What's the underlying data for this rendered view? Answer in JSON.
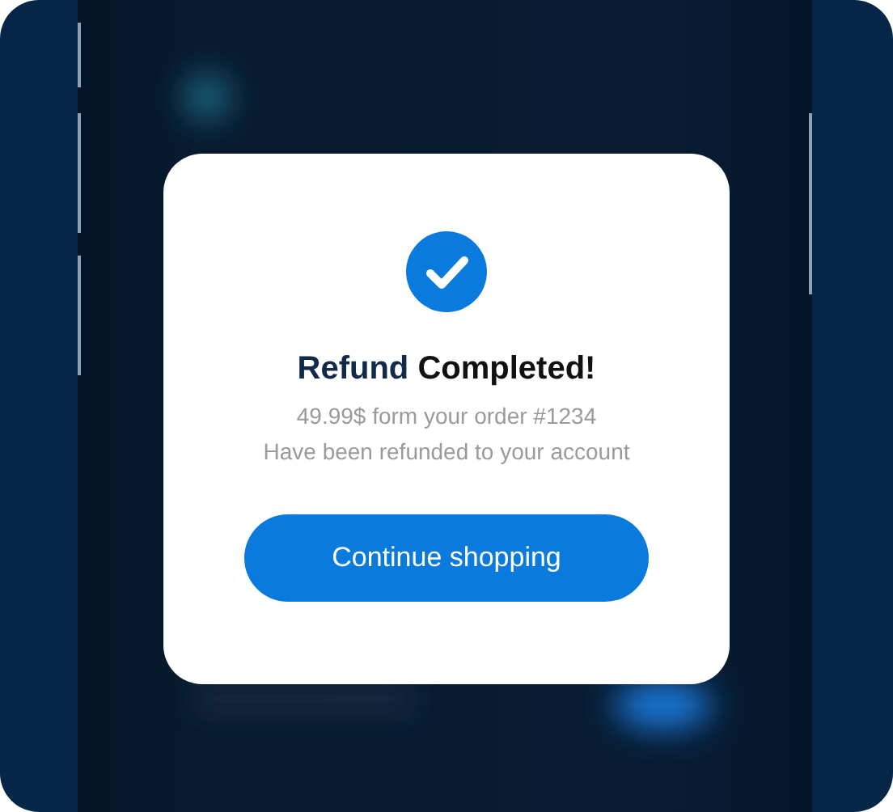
{
  "dialog": {
    "title": [
      {
        "text": "Refund",
        "color": "#12294a"
      },
      {
        "text": "Completed!",
        "color": "#111111"
      }
    ],
    "message": [
      "49.99$ form your order #1234",
      "Have been refunded to your account"
    ],
    "button": "Continue shopping"
  }
}
